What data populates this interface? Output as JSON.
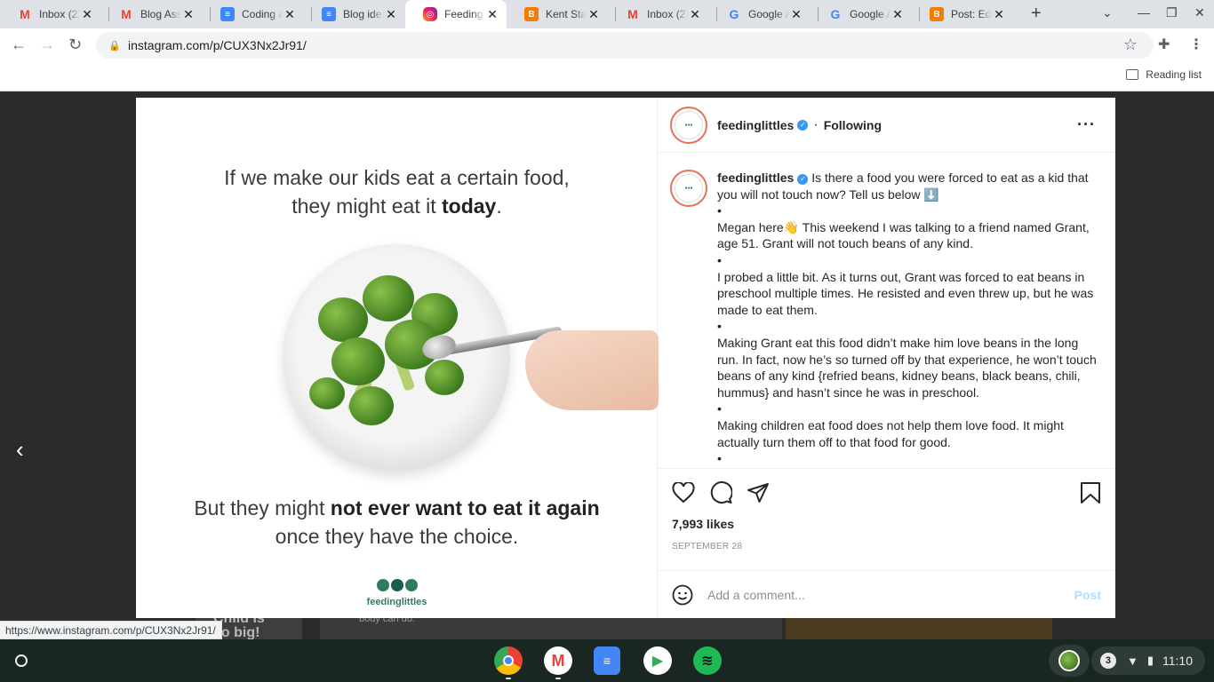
{
  "browser": {
    "tabs": [
      {
        "title": "Inbox (2)",
        "icon": "gmail-icon",
        "fav": "M"
      },
      {
        "title": "Blog Assi",
        "icon": "gmail-icon",
        "fav": "M"
      },
      {
        "title": "Coding a",
        "icon": "docs-icon",
        "fav": "≡"
      },
      {
        "title": "Blog idea",
        "icon": "docs-icon",
        "fav": "≡"
      },
      {
        "title": "Feeding L",
        "icon": "instagram-icon",
        "fav": "◎"
      },
      {
        "title": "Kent Stat",
        "icon": "blogger-icon",
        "fav": "B"
      },
      {
        "title": "Inbox (2)",
        "icon": "gmail-icon",
        "fav": "M"
      },
      {
        "title": "Google A",
        "icon": "google-icon",
        "fav": "G"
      },
      {
        "title": "Google A",
        "icon": "google-icon",
        "fav": "G"
      },
      {
        "title": "Post: Edi",
        "icon": "blogger-icon",
        "fav": "B"
      }
    ],
    "active_tab_index": 4,
    "url": "instagram.com/p/CUX3Nx2Jr91/",
    "reading_list_label": "Reading list",
    "status_url": "https://www.instagram.com/p/CUX3Nx2Jr91/"
  },
  "post": {
    "username": "feedinglittles",
    "follow_state": "Following",
    "image": {
      "line1": "If we make our kids eat a certain food,",
      "line2_plain": "they might eat it ",
      "line2_bold": "today",
      "line2_end": ".",
      "line3_plain": "But they might ",
      "line3_bold": "not ever want to eat it again",
      "line4": "once they have the choice.",
      "logo_text": "feedinglittles"
    },
    "caption": {
      "intro": "Is there a food you were forced to eat as a kid that you will not touch now? Tell us below ⬇️",
      "bullet": "•",
      "p1": "Megan here👋 This weekend I was talking to a friend named Grant, age 51. Grant will not touch beans of any kind.",
      "p2": "I probed a little bit. As it turns out, Grant was forced to eat beans in preschool multiple times. He resisted and even threw up, but he was made to eat them.",
      "p3": "Making Grant eat this food didn’t make him love beans in the long run. In fact, now he’s so turned off by that experience, he won’t touch beans of any kind {refried beans, kidney beans, black beans, chili, hummus} and hasn’t since he was in preschool.",
      "p4": "Making children eat food does not help them love food. It might actually turn them off to that food for good."
    },
    "likes": "7,993 likes",
    "date": "SEPTEMBER 28",
    "comment_placeholder": "Add a comment...",
    "post_label": "Post"
  },
  "backdrop": {
    "peek_text": "Child is so big!",
    "peek_text2": "body can do.”"
  },
  "shelf": {
    "apps": [
      "chrome-icon",
      "gmail-icon",
      "docs-icon",
      "play-store-icon",
      "spotify-icon"
    ],
    "notification_count": "3",
    "time": "11:10"
  },
  "colors": {
    "verified": "#3897f0",
    "post_disabled": "#b2dffc",
    "brand_green": "#2e7d5b"
  }
}
